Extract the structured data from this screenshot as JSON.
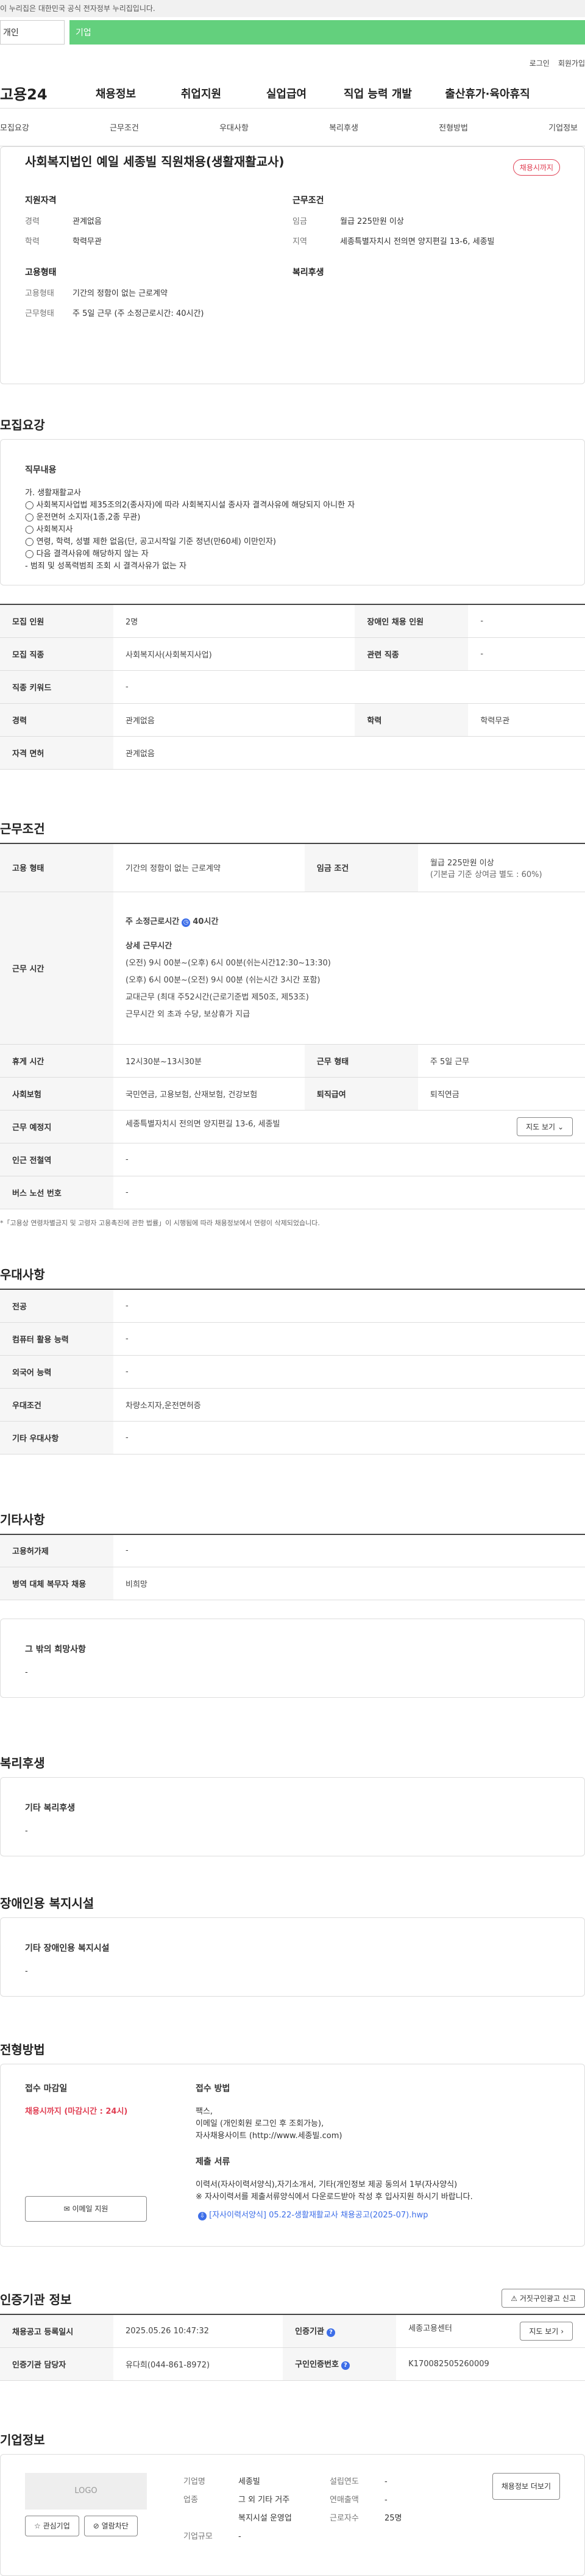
{
  "gov_bar": "이 누리집은 대한민국 공식 전자정부 누리집입니다.",
  "user_tabs": [
    "개인",
    "기업"
  ],
  "top_links": [
    "로그인",
    "회원가입"
  ],
  "logo": "고용24",
  "menu": [
    "채용정보",
    "취업지원",
    "실업급여",
    "직업 능력 개발",
    "출산휴가·육아휴직"
  ],
  "subnav": [
    "모집요강",
    "근무조건",
    "우대사항",
    "복리후생",
    "전형방법",
    "기업정보"
  ],
  "job": {
    "title": "사회복지법인 예일 세종빌 직원채용(생활재활교사)",
    "badge": "채용시까지",
    "qual_title": "지원자격",
    "cond_title": "근무조건",
    "emp_title": "고용형태",
    "wel_title": "복리후생",
    "career_k": "경력",
    "career_v": "관계없음",
    "edu_k": "학력",
    "edu_v": "학력무관",
    "pay_k": "임금",
    "pay_v": "월급 225만원 이상",
    "area_k": "지역",
    "area_v": "세종특별자치시 전의면 양지편길 13-6, 세종빌",
    "emptype_k": "고용형태",
    "emptype_v": "기간의 정함이 없는 근로계약",
    "worktype_k": "근무형태",
    "worktype_v": "주 5일 근무 (주 소정근로시간: 40시간)"
  },
  "recruit": {
    "section": "모집요강",
    "duty_title": "직무내용",
    "duty_lines": [
      "가. 생활재활교사",
      "◯ 사회복지사업법 제35조의2(종사자)에 따라 사회복지시설 종사자 결격사유에 해당되지 아니한 자",
      "◯ 운전면허 소지자(1종,2종 무관)",
      "◯ 사회복지사",
      "◯ 연령, 학력, 성별 제한 없음(단, 공고시작일 기준 정년(만60세) 이만인자)",
      "◯ 다음 결격사유에 해당하지 않는 자",
      "  - 범죄 및 성폭력범죄 조회 시 결격사유가 없는 자"
    ],
    "rows": [
      [
        "모집 인원",
        "2명",
        "장애인 채용 인원",
        "-"
      ],
      [
        "모집 직종",
        "사회복지사(사회복지사업)",
        "관련 직종",
        "-"
      ],
      [
        "직종 키워드",
        "-",
        "",
        ""
      ],
      [
        "경력",
        "관계없음",
        "학력",
        "학력무관"
      ],
      [
        "자격 면허",
        "관계없음",
        "",
        ""
      ]
    ]
  },
  "cond": {
    "section": "근무조건",
    "emp_k": "고용 형태",
    "emp_v": "기간의 정함이 없는 근로계약",
    "pay_k": "임금 조건",
    "pay_v1": "월급 225만원 이상",
    "pay_v2": "(기본급 기준 상여금 별도 : 60%)",
    "time_k": "근무 시간",
    "time_lines": [
      "주 소정근로시간",
      "40시간",
      "상세 근무시간",
      "(오전) 9시 00분~(오후) 6시 00분(쉬는시간12:30~13:30)",
      "(오후) 6시 00분~(오전) 9시 00분 (쉬는시간 3시간 포함)",
      "교대근무 (최대 주52시간(근로기준법 제50조, 제53조)",
      "근무시간 외 초과 수당, 보상휴가 지급"
    ],
    "rest_k": "휴게 시간",
    "rest_v": "12시30분~13시30분",
    "wt_k": "근무 형태",
    "wt_v": "주 5일 근무",
    "ins_k": "사회보험",
    "ins_v": "국민연금, 고용보험, 산재보험, 건강보험",
    "ret_k": "퇴직급여",
    "ret_v": "퇴직연금",
    "place_k": "근무 예정지",
    "place_v": "세종특별자치시 전의면 양지편길 13-6, 세종빌",
    "map_btn": "지도 보기",
    "sub_k": "인근 전철역",
    "sub_v": "-",
    "bus_k": "버스 노선 번호",
    "bus_v": "-",
    "note": "*「고용상 연령차별금지 및 고령자 고용촉진에 관한 법률」이 시행됨에 따라 채용정보에서 연령이 삭제되었습니다."
  },
  "pref": {
    "section": "우대사항",
    "rows": [
      [
        "전공",
        "-"
      ],
      [
        "컴퓨터 활용 능력",
        "-"
      ],
      [
        "외국어 능력",
        "-"
      ],
      [
        "우대조건",
        "차량소지자,운전면허증"
      ],
      [
        "기타 우대사항",
        "-"
      ]
    ]
  },
  "etc": {
    "section": "기타사항",
    "rows": [
      [
        "고용허가제",
        "-"
      ],
      [
        "병역 대체 복무자 채용",
        "비희망"
      ]
    ],
    "hope_title": "그 밖의 희망사항",
    "hope_v": "-"
  },
  "welfare": {
    "section": "복리후생",
    "title": "기타 복리후생",
    "v": "-"
  },
  "disab": {
    "section": "장애인용 복지시설",
    "title": "기타 장애인용 복지시설",
    "v": "-"
  },
  "method": {
    "section": "전형방법",
    "deadline_title": "접수 마감일",
    "deadline_v": "채용시까지 (마감시간 : 24시)",
    "email_btn": "이메일 지원",
    "way_title": "접수 방법",
    "way_lines": [
      "팩스,",
      "이메일 (개인회원 로그인 후 조회가능),",
      "자사채용사이트 (http://www.세종빌.com)"
    ],
    "doc_title": "제출 서류",
    "doc_lines": [
      "이력서(자사이력서양식),자기소개서, 기타(개인정보 제공 동의서 1부(자사양식)",
      "※ 자사이력서를 제출서류양식에서 다운로드받아 작성 후 입사지원 하시기 바랍니다."
    ],
    "file": "[자사이력서양식] 05.22-생활재활교사 채용공고(2025-07).hwp"
  },
  "org": {
    "section": "인증기관 정보",
    "report_btn": "거짓구인광고 신고",
    "reg_k": "채용공고 등록일시",
    "reg_v": "2025.05.26 10:47:32",
    "inst_k": "인증기관",
    "inst_v": "세종고용센터",
    "map_btn": "지도 보기",
    "mgr_k": "인증기관 담당자",
    "mgr_v": "유다희(044-861-8972)",
    "no_k": "구인인증번호",
    "no_v": "K170082505260009"
  },
  "company": {
    "section": "기업정보",
    "logo": "LOGO",
    "fav_btn": "관심기업",
    "block_btn": "열람차단",
    "name_k": "기업명",
    "name_v": "세종빌",
    "ind_k": "업종",
    "ind_v1": "그 외 기타 거주",
    "ind_v2": "복지시설 운영업",
    "size_k": "기업규모",
    "size_v": "-",
    "est_k": "설립연도",
    "est_v": "-",
    "sales_k": "연매출액",
    "sales_v": "-",
    "emp_k": "근로자수",
    "emp_v": "25명",
    "more_btn": "채용정보 더보기"
  }
}
